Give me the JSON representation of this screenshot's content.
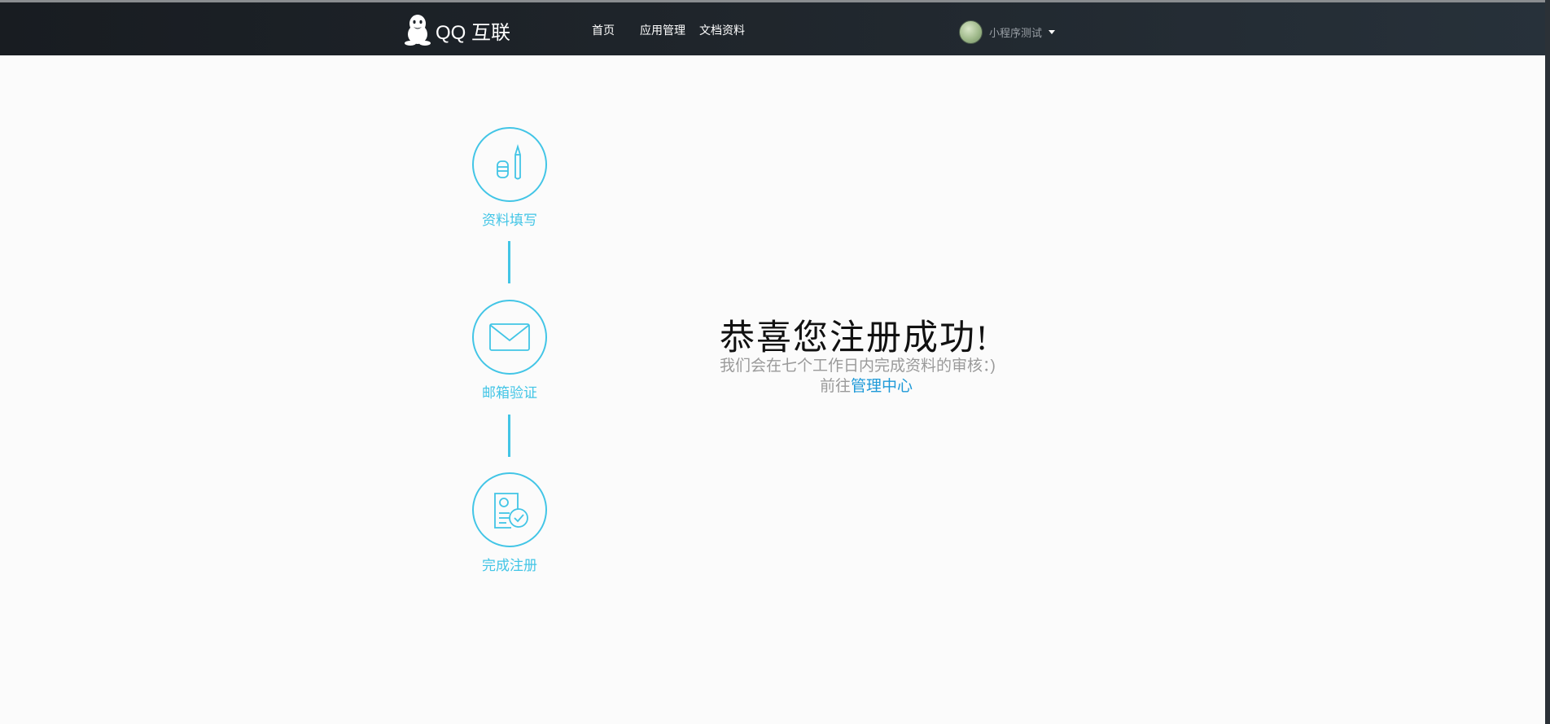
{
  "header": {
    "logo_text": "QQ 互联",
    "nav": {
      "home": "首页",
      "apps": "应用管理",
      "docs": "文档资料"
    },
    "user": {
      "name": "小程序测试"
    }
  },
  "steps": [
    {
      "label": "资料填写",
      "icon": "pencil-icon"
    },
    {
      "label": "邮箱验证",
      "icon": "envelope-icon"
    },
    {
      "label": "完成注册",
      "icon": "certificate-check-icon"
    }
  ],
  "main": {
    "title": "恭喜您注册成功!",
    "description": "我们会在七个工作日内完成资料的审核：)",
    "goto_prefix": "前往",
    "goto_link": "管理中心"
  },
  "colors": {
    "accent": "#42c5e6",
    "link": "#1f9ad8",
    "header_bg": "#1f252b"
  }
}
